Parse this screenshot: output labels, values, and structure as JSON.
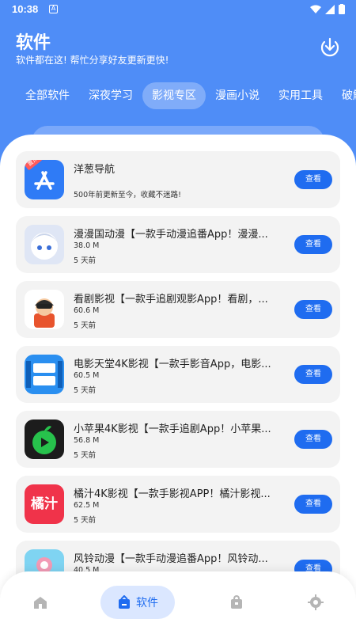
{
  "status_bar": {
    "time": "10:38",
    "notif_letter": "A"
  },
  "header": {
    "title": "软件",
    "subtitle": "软件都在这! 帮忙分享好友更新更快!"
  },
  "tabs": [
    {
      "label": "全部软件",
      "active": false
    },
    {
      "label": "深夜学习",
      "active": false
    },
    {
      "label": "影视专区",
      "active": true
    },
    {
      "label": "漫画小说",
      "active": false
    },
    {
      "label": "实用工具",
      "active": false
    },
    {
      "label": "破解",
      "active": false
    }
  ],
  "view_label": "查看",
  "apps": [
    {
      "name": "洋葱导航",
      "note": "500年前更新至今，收藏不迷路!",
      "badge": "置顶",
      "icon": "app-store-icon",
      "color": "#2f7bf6"
    },
    {
      "name": "漫漫国动漫【一款手动漫追番App！漫漫...",
      "size": "38.0 M",
      "date": "5 天前",
      "icon": "anime-girl-icon",
      "color": "#dfe6f5"
    },
    {
      "name": "看剧影视【一款手追剧观影App！看剧，...",
      "size": "60.6 M",
      "date": "5 天前",
      "icon": "cartoon-boy-icon",
      "color": "#ffffff"
    },
    {
      "name": "电影天堂4K影视【一款手影音App，电影...",
      "size": "60.5 M",
      "date": "5 天前",
      "icon": "film-heaven-icon",
      "color": "#2a8ff0"
    },
    {
      "name": "小苹果4K影视【一款手追剧App！小苹果...",
      "size": "56.8 M",
      "date": "5 天前",
      "icon": "green-apple-icon",
      "color": "#1c1c1c"
    },
    {
      "name": "橘汁4K影视【一款手影视APP！橘汁影视...",
      "size": "62.5 M",
      "date": "5 天前",
      "icon": "orange-juice-icon",
      "color": "#f0334a",
      "icon_text": "橘汁"
    },
    {
      "name": "风铃动漫【一款手动漫追番App！风铃动...",
      "size": "40.5 M",
      "date": "",
      "icon": "wind-chime-icon",
      "color": "#7fd4f2"
    }
  ],
  "bottom_nav": {
    "active_label": "软件",
    "items": [
      "home-icon",
      "software-icon",
      "shop-bag-icon",
      "settings-icon"
    ]
  },
  "colors": {
    "primary": "#4f8df7",
    "button": "#1f6cf0"
  }
}
